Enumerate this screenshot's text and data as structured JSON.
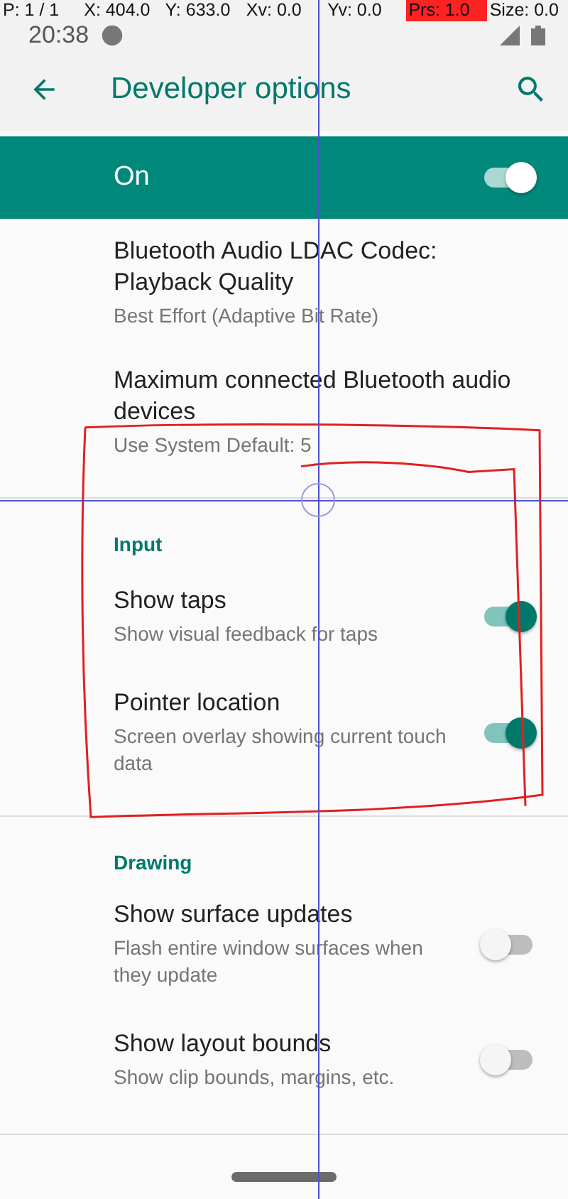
{
  "status_bar": {
    "time": "20:38"
  },
  "pointer_overlay": {
    "fields": [
      {
        "text": "P: 1 / 1",
        "highlighted": false
      },
      {
        "text": "X: 404.0",
        "highlighted": false
      },
      {
        "text": "Y: 633.0",
        "highlighted": false
      },
      {
        "text": "Xv: 0.0",
        "highlighted": false
      },
      {
        "text": "Yv: 0.0",
        "highlighted": false
      },
      {
        "text": "Prs: 1.0",
        "highlighted": true
      },
      {
        "text": "Size: 0.0",
        "highlighted": false
      }
    ]
  },
  "toolbar": {
    "title": "Developer options"
  },
  "master_switch": {
    "label": "On",
    "on": true
  },
  "sections": [
    {
      "items": [
        {
          "title": "Bluetooth Audio LDAC Codec: Playback Quality",
          "summary": "Best Effort (Adaptive Bit Rate)"
        },
        {
          "title": "Maximum connected Bluetooth audio devices",
          "summary": "Use System Default: 5"
        }
      ]
    },
    {
      "header": "Input",
      "items": [
        {
          "title": "Show taps",
          "summary": "Show visual feedback for taps",
          "on": true
        },
        {
          "title": "Pointer location",
          "summary": "Screen overlay showing current touch data",
          "on": true
        }
      ]
    },
    {
      "header": "Drawing",
      "items": [
        {
          "title": "Show surface updates",
          "summary": "Flash entire window surfaces when they update",
          "on": false
        },
        {
          "title": "Show layout bounds",
          "summary": "Show clip bounds, margins, etc.",
          "on": false
        }
      ]
    }
  ]
}
